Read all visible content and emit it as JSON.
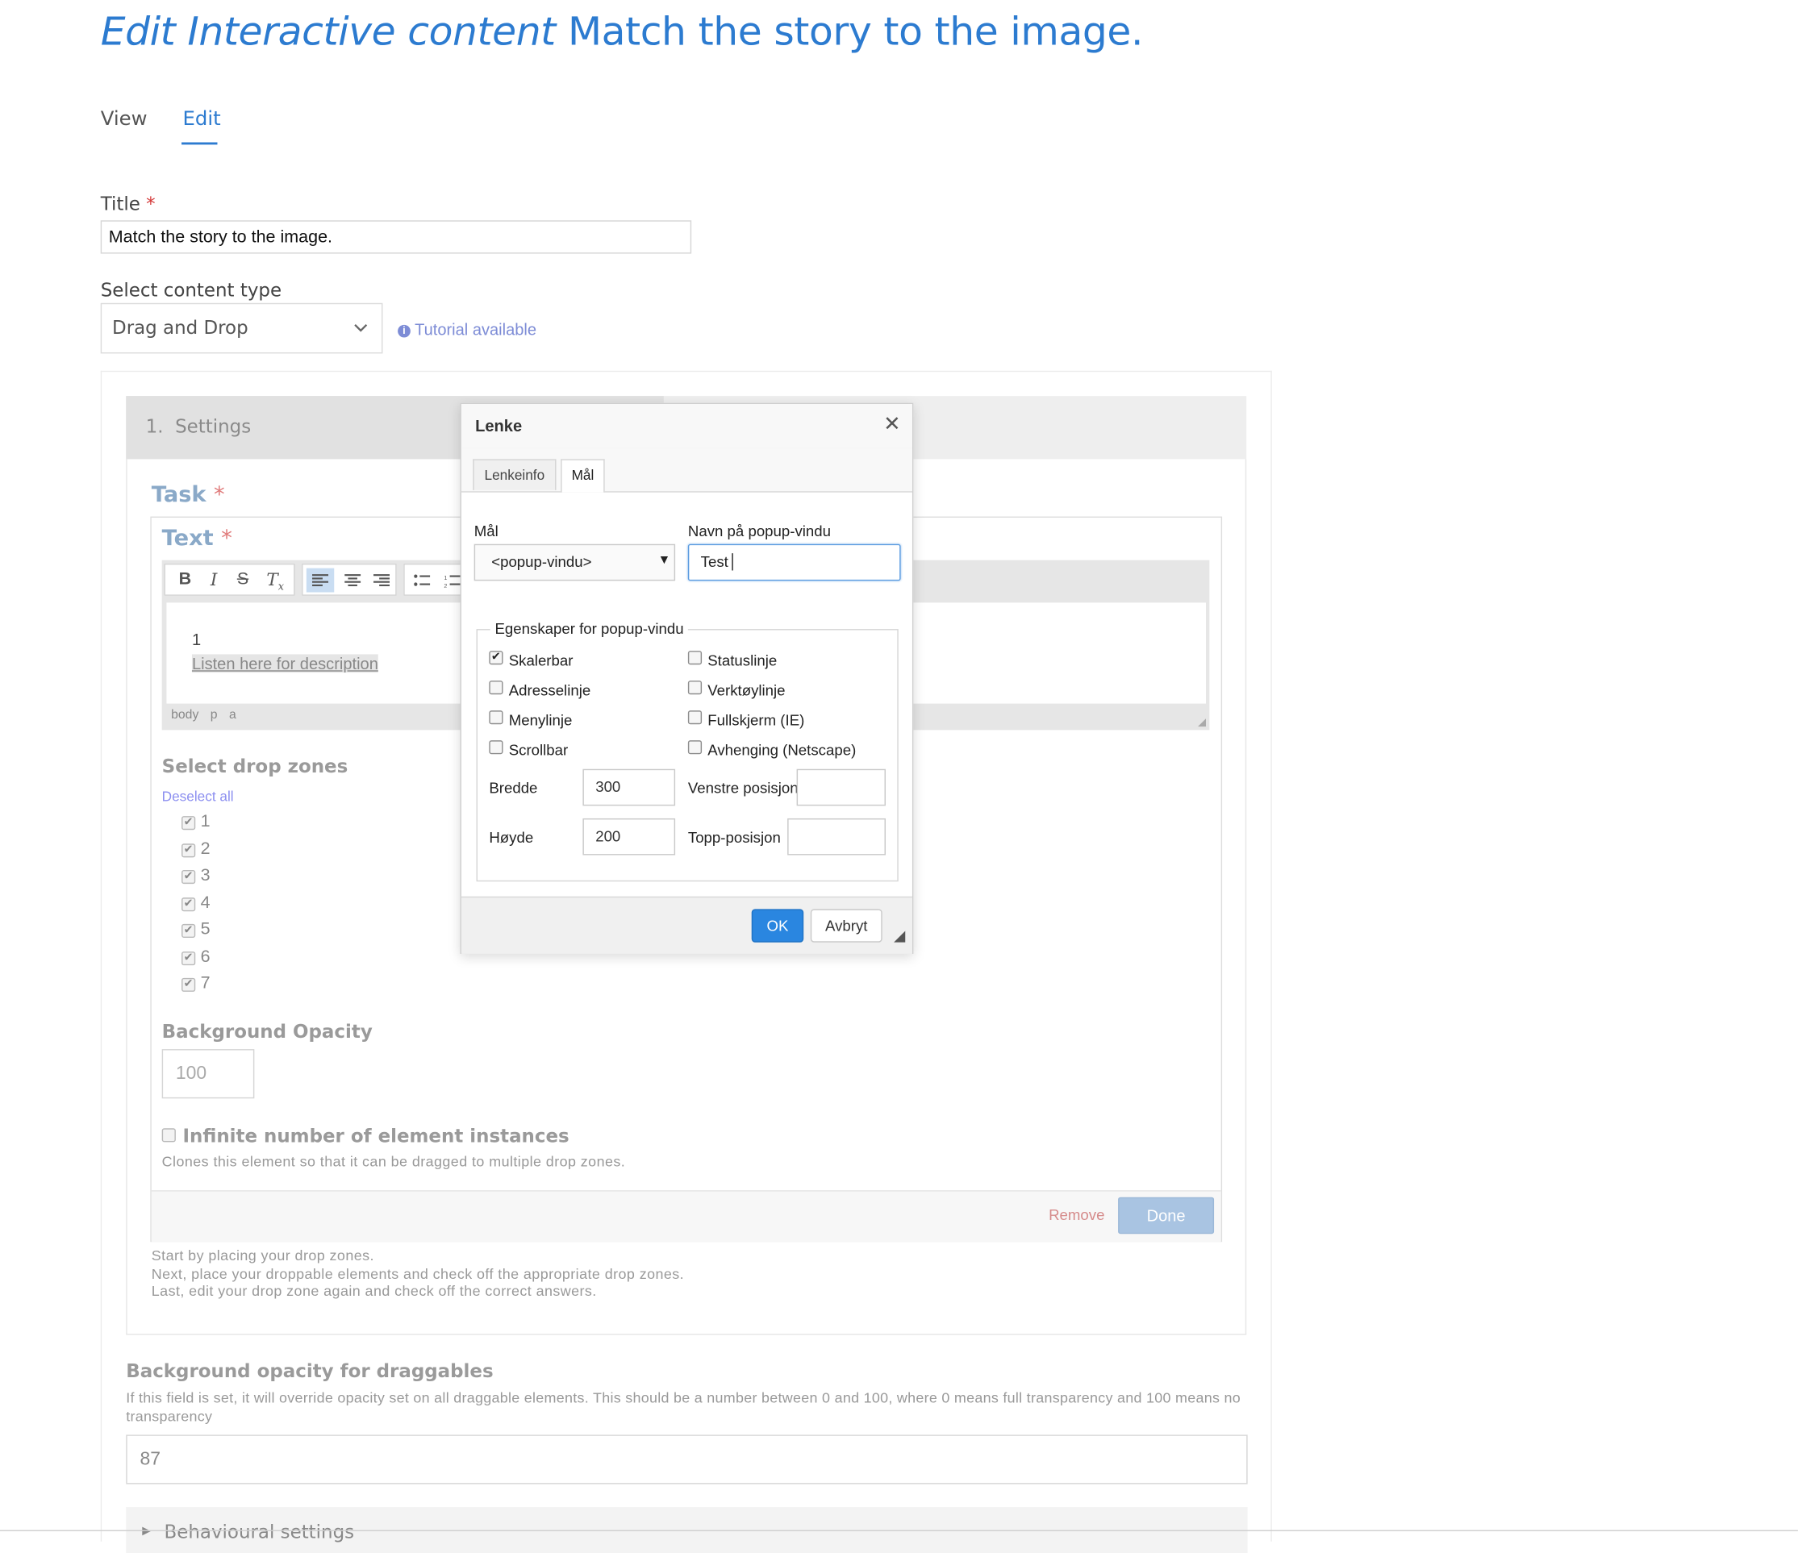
{
  "header": {
    "title_prefix": "Edit Interactive content",
    "title_name": "Match the story to the image."
  },
  "tabs": {
    "view": "View",
    "edit": "Edit"
  },
  "form": {
    "title_label": "Title",
    "required_mark": "*",
    "title_value": "Match the story to the image.",
    "content_type_label": "Select content type",
    "content_type_value": "Drag and Drop",
    "tutorial_link": "Tutorial available"
  },
  "editor": {
    "step_label": "1.  Settings",
    "task_label": "Task",
    "text_label": "Text",
    "body_line1": "1",
    "body_line2": "Listen here for description",
    "path": [
      "body",
      "p",
      "a"
    ],
    "drop_zones_label": "Select drop zones",
    "deselect_all": "Deselect all",
    "zones": [
      "1",
      "2",
      "3",
      "4",
      "5",
      "6",
      "7"
    ],
    "bg_opacity_label": "Background Opacity",
    "bg_opacity_value": "100",
    "infinite_label": "Infinite number of element instances",
    "infinite_help": "Clones this element so that it can be dragged to multiple drop zones.",
    "remove_label": "Remove",
    "done_label": "Done",
    "help_lines": [
      "Start by placing your drop zones.",
      "Next, place your droppable elements and check off the appropriate drop zones.",
      "Last, edit your drop zone again and check off the correct answers."
    ],
    "bg_drag_label": "Background opacity for draggables",
    "bg_drag_help": "If this field is set, it will override opacity set on all draggable elements. This should be a number between 0 and 100, where 0 means full transparency and 100 means no transparency",
    "bg_drag_value": "87",
    "behavioural_label": "Behavioural settings"
  },
  "dialog": {
    "title": "Lenke",
    "tabs": [
      "Lenkeinfo",
      "Mål"
    ],
    "target_label": "Mål",
    "target_value": "<popup-vindu>",
    "popup_name_label": "Navn på popup-vindu",
    "popup_name_value": "Test",
    "fieldset_legend": "Egenskaper for popup-vindu",
    "checks_left": [
      {
        "label": "Skalerbar",
        "checked": true
      },
      {
        "label": "Adresselinje",
        "checked": false
      },
      {
        "label": "Menylinje",
        "checked": false
      },
      {
        "label": "Scrollbar",
        "checked": false
      }
    ],
    "checks_right": [
      {
        "label": "Statuslinje",
        "checked": false
      },
      {
        "label": "Verktøylinje",
        "checked": false
      },
      {
        "label": "Fullskjerm (IE)",
        "checked": false
      },
      {
        "label": "Avhenging (Netscape)",
        "checked": false
      }
    ],
    "width_label": "Bredde",
    "width_value": "300",
    "left_label": "Venstre posisjon",
    "left_value": "",
    "height_label": "Høyde",
    "height_value": "200",
    "top_label": "Topp-posisjon",
    "top_value": "",
    "ok_label": "OK",
    "cancel_label": "Avbryt"
  },
  "colors": {
    "accent": "#2c7bd0",
    "required": "#d43838",
    "ok_button": "#2a86e0",
    "done_button": "#a9c4e2",
    "remove": "#d58a8a"
  }
}
